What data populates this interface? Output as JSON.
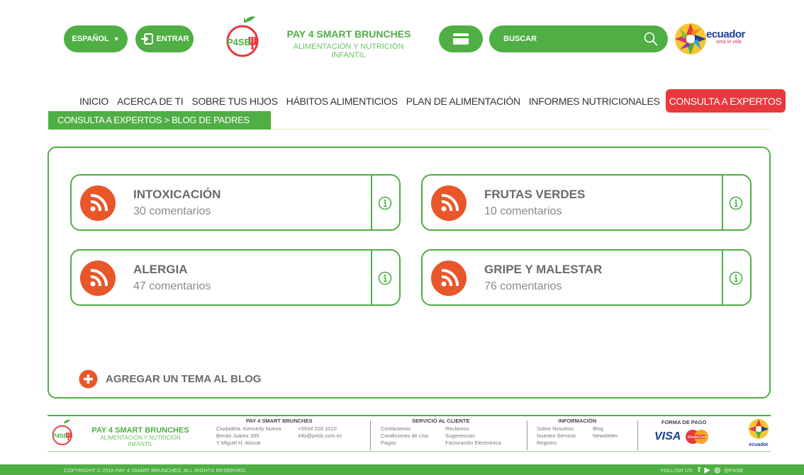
{
  "header": {
    "language_label": "ESPAÑOL",
    "login_label": "ENTRAR",
    "logo_text": "P4SB",
    "brand_title": "PAY 4 SMART BRUNCHES",
    "brand_subtitle": "ALIMENTACIÓN Y NUTRICIÓN INFANTIL",
    "search_placeholder": "BUSCAR",
    "partner_logo_word": "ecuador",
    "partner_logo_tagline": "ama la vida"
  },
  "nav": {
    "items": [
      {
        "label": "INICIO"
      },
      {
        "label": "ACERCA DE TI"
      },
      {
        "label": "SOBRE TUS HIJOS"
      },
      {
        "label": "HÁBITOS ALIMENTICIOS"
      },
      {
        "label": "PLAN DE ALIMENTACIÓN"
      },
      {
        "label": "INFORMES NUTRICIONALES"
      },
      {
        "label": "CONSULTA A EXPERTOS",
        "active": true
      }
    ]
  },
  "breadcrumb": "CONSULTA A EXPERTOS > BLOG DE PADRES",
  "topics": [
    {
      "title": "INTOXICACIÓN",
      "comments": "30 comentarios"
    },
    {
      "title": "FRUTAS VERDES",
      "comments": "10 comentarios"
    },
    {
      "title": "ALERGIA",
      "comments": "47 comentarios"
    },
    {
      "title": "GRIPE Y MALESTAR",
      "comments": "76 comentarios"
    }
  ],
  "add_topic_label": "AGREGAR UN TEMA AL BLOG",
  "footer": {
    "brand_title": "PAY 4 SMART BRUNCHES",
    "brand_subtitle": "ALIMENTACIÓN Y NUTRICIÓN INFANTIL",
    "company": {
      "heading": "PAY 4 SMART BRUNCHES",
      "lines": [
        "Ciudadela. Kennedy Nueva",
        "+5934 228 1010",
        "Benito Juárez 305",
        "info@p4sb.com.ec",
        "Y Miguel H. Alcivar",
        ""
      ]
    },
    "service": {
      "heading": "SERVICIO AL CLIENTE",
      "links": [
        "Contáctenos",
        "Reclamos",
        "Condiciones de Uso",
        "Sugerencias",
        "Pagos",
        "Facturación Electrónica"
      ]
    },
    "info": {
      "heading": "INFORMACIÓN",
      "links": [
        "Sobre Nosotros",
        "Blog",
        "Nuestro Servicio",
        "Newsletter",
        "Registro",
        ""
      ]
    },
    "payment": {
      "heading": "FORMA DE PAGO",
      "visa": "VISA",
      "mastercard": "MasterCard"
    },
    "partner_logo_word": "ecuador",
    "copyright": "COPYRIGHT © 2016 PAY 4 SMART BRUNCHES. ALL RIGHTS RESERVED.",
    "follow_label": "FOLLOW US:",
    "handle": "@P4SB"
  },
  "colors": {
    "brand_green": "#4fae44",
    "accent_red": "#e8393d",
    "rss_orange": "#e8562a"
  },
  "icons": [
    "chevron-down-icon",
    "login-icon",
    "credit-card-icon",
    "search-icon",
    "rss-icon",
    "info-icon",
    "plus-circle-icon",
    "facebook-icon",
    "youtube-icon",
    "instagram-icon"
  ]
}
